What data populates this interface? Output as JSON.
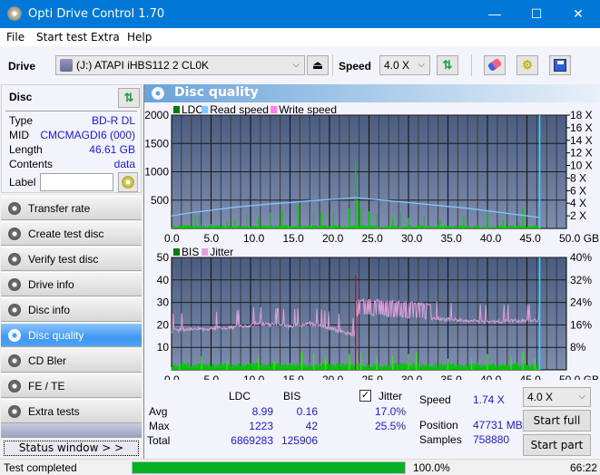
{
  "window": {
    "title": "Opti Drive Control 1.70",
    "minimize": "—",
    "maximize": "☐",
    "close": "✕"
  },
  "menu": [
    {
      "label": "File",
      "accel": "F"
    },
    {
      "label": "Start test",
      "accel": "S"
    },
    {
      "label": "Extra",
      "accel": "x"
    },
    {
      "label": "Help",
      "accel": "H"
    }
  ],
  "toolbar": {
    "drive_label": "Drive",
    "drive_value": "(J:)  ATAPI iHBS112  2 CL0K",
    "eject_icon": "eject-icon",
    "speed_label": "Speed",
    "speed_value": "4.0 X",
    "icons": [
      "refresh-icon",
      "erase-icon",
      "settings-icon",
      "save-icon"
    ]
  },
  "disc": {
    "header": "Disc",
    "rows": [
      {
        "key": "Type",
        "value": "BD-R DL"
      },
      {
        "key": "MID",
        "value": "CMCMAGDI6 (000)"
      },
      {
        "key": "Length",
        "value": "46.61 GB"
      },
      {
        "key": "Contents",
        "value": "data"
      }
    ],
    "label_key": "Label",
    "label_value": ""
  },
  "nav": [
    {
      "label": "Transfer rate",
      "active": false
    },
    {
      "label": "Create test disc",
      "active": false
    },
    {
      "label": "Verify test disc",
      "active": false
    },
    {
      "label": "Drive info",
      "active": false
    },
    {
      "label": "Disc info",
      "active": false
    },
    {
      "label": "Disc quality",
      "active": true
    },
    {
      "label": "CD Bler",
      "active": false
    },
    {
      "label": "FE / TE",
      "active": false
    },
    {
      "label": "Extra tests",
      "active": false
    }
  ],
  "status_window_label": "Status window > >",
  "panel": {
    "title": "Disc quality"
  },
  "chart_data": [
    {
      "type": "bar",
      "title": "LDC / Read speed",
      "legend": [
        {
          "name": "LDC",
          "color": "#008000"
        },
        {
          "name": "Read speed",
          "color": "#80c8ff"
        },
        {
          "name": "Write speed",
          "color": "#ff80e0"
        }
      ],
      "legend_position": "top-left",
      "xlabel": "GB",
      "xlim": [
        0,
        50
      ],
      "x_ticks": [
        "0.0",
        "5.0",
        "10.0",
        "15.0",
        "20.0",
        "25.0",
        "30.0",
        "35.0",
        "40.0",
        "45.0",
        "50.0 GB"
      ],
      "ylim": [
        0,
        2000
      ],
      "y_ticks": [
        "500",
        "1000",
        "1500",
        "2000"
      ],
      "y2lim": [
        0,
        18
      ],
      "y2_ticks": [
        "2 X",
        "4 X",
        "6 X",
        "8 X",
        "10 X",
        "12 X",
        "14 X",
        "16 X",
        "18 X"
      ],
      "grid": true,
      "end_marker_gb": 46.61,
      "read_speed": {
        "x": [
          0,
          2.5,
          5,
          7.5,
          10,
          12.5,
          15,
          17.5,
          20,
          22.5,
          23.3,
          25,
          27.5,
          30,
          32.5,
          35,
          37.5,
          40,
          42.5,
          45,
          46.6
        ],
        "y": [
          2.0,
          2.5,
          2.9,
          3.3,
          3.6,
          3.9,
          4.1,
          4.4,
          4.6,
          4.8,
          4.9,
          4.7,
          4.4,
          4.1,
          3.8,
          3.5,
          3.2,
          2.8,
          2.4,
          2.0,
          1.74
        ]
      },
      "ldc_peaks": {
        "x": [
          1,
          3,
          3.5,
          5,
          7,
          8,
          9.5,
          11,
          12.5,
          14,
          16,
          18,
          19,
          20.5,
          22.5,
          23.3,
          23.6,
          24,
          25,
          26,
          28,
          29,
          30,
          32,
          34,
          37,
          40,
          42,
          44,
          44.5,
          46
        ],
        "y": [
          60,
          230,
          250,
          80,
          130,
          150,
          250,
          200,
          280,
          300,
          420,
          260,
          280,
          300,
          350,
          1223,
          500,
          350,
          300,
          250,
          200,
          280,
          190,
          220,
          150,
          200,
          300,
          150,
          100,
          360,
          60
        ]
      },
      "ldc_baseline": 30
    },
    {
      "type": "bar",
      "title": "BIS / Jitter",
      "legend": [
        {
          "name": "BIS",
          "color": "#008000"
        },
        {
          "name": "Jitter",
          "color": "#e0a0e0"
        }
      ],
      "legend_position": "top-left",
      "xlabel": "GB",
      "xlim": [
        0,
        50
      ],
      "x_ticks": [
        "0.0",
        "5.0",
        "10.0",
        "15.0",
        "20.0",
        "25.0",
        "30.0",
        "35.0",
        "40.0",
        "45.0",
        "50.0 GB"
      ],
      "ylim": [
        0,
        50
      ],
      "y_ticks": [
        "10",
        "20",
        "30",
        "40",
        "50"
      ],
      "y2lim": [
        0,
        40
      ],
      "y2_ticks": [
        "8%",
        "16%",
        "24%",
        "32%",
        "40%"
      ],
      "grid": true,
      "end_marker_gb": 46.61,
      "red_marker_gb": 23.3,
      "red_marker_value": 42,
      "jitter": {
        "x": [
          0,
          2.5,
          5,
          7.5,
          10,
          10.5,
          12.5,
          15,
          17.5,
          20,
          22,
          23.2,
          23.4,
          25,
          27.5,
          30,
          32.5,
          35,
          37.5,
          40,
          42.5,
          45,
          46.6
        ],
        "y": [
          14.0,
          14.5,
          14.6,
          15.2,
          15.8,
          16.5,
          16.0,
          15.6,
          16.5,
          14.8,
          13.4,
          12.4,
          20.0,
          20.0,
          19.6,
          19.2,
          18.5,
          18.0,
          17.6,
          17.3,
          17.4,
          17.5,
          17.8
        ]
      },
      "bis_baseline": 2,
      "bis_peaks": {
        "x": [
          1,
          3.8,
          7,
          11,
          13,
          16.5,
          18,
          19.5,
          22.5,
          23.5,
          24,
          26,
          28,
          30,
          31,
          35,
          38,
          40,
          43,
          44.5,
          46
        ],
        "y": [
          3,
          6,
          4,
          5,
          4,
          8,
          7,
          5,
          7,
          8,
          8,
          6,
          6,
          7,
          8,
          5,
          5,
          7,
          6,
          8,
          5
        ]
      }
    }
  ],
  "stats": {
    "col_ldc": "LDC",
    "col_bis": "BIS",
    "rows": [
      {
        "label": "Avg",
        "ldc": "8.99",
        "bis": "0.16",
        "jitter": "17.0%"
      },
      {
        "label": "Max",
        "ldc": "1223",
        "bis": "42",
        "jitter": "25.5%"
      },
      {
        "label": "Total",
        "ldc": "6869283",
        "bis": "125906"
      }
    ],
    "jitter_label": "Jitter",
    "jitter_checked": true,
    "speed_label": "Speed",
    "speed_value": "1.74 X",
    "position_label": "Position",
    "position_value": "47731 MB",
    "samples_label": "Samples",
    "samples_value": "758880",
    "speed_select": "4.0 X",
    "start_full": "Start full",
    "start_part": "Start part"
  },
  "statusbar": {
    "text": "Test completed",
    "progress": 100.0,
    "progress_text": "100.0%",
    "time": "66:22"
  },
  "colors": {
    "accent": "#0078d7",
    "ldc": "#00c800",
    "read_speed": "#80c8ff",
    "jitter": "#d8a0d8",
    "progress": "#06b025",
    "value_text": "#1a1ae0"
  }
}
